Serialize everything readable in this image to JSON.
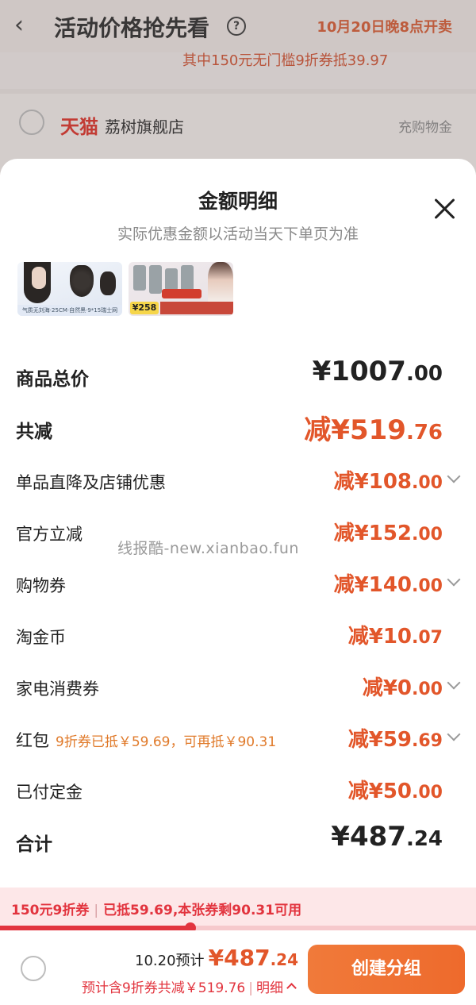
{
  "background": {
    "title": "活动价格抢先看",
    "sale_time": "10月20日晚8点开卖",
    "coupon_line": "其中150元无门槛9折券抵39.97",
    "tmall_logo": "天猫",
    "shop_name": "荔树旗舰店",
    "gather_link": "充购物金"
  },
  "sheet": {
    "title": "金额明细",
    "subtitle": "实际优惠金额以活动当天下单页为准",
    "thumb1_caption": "气质无刘海·25CM·自然黑·9*15瑞士网",
    "thumb2_price": "¥258"
  },
  "rows": [
    {
      "label": "商品总价",
      "amount": "¥1007",
      "dec": ".00"
    },
    {
      "label": "共减",
      "amount": "减¥519",
      "dec": ".76"
    },
    {
      "label": "单品直降及店铺优惠",
      "amount": "减¥108",
      "dec": ".00"
    },
    {
      "label": "官方立减",
      "amount": "减¥152",
      "dec": ".00"
    },
    {
      "label": "购物券",
      "amount": "减¥140",
      "dec": ".00"
    },
    {
      "label": "淘金币",
      "amount": "减¥10",
      "dec": ".07"
    },
    {
      "label": "家电消费券",
      "amount": "减¥0",
      "dec": ".00"
    },
    {
      "label": "红包",
      "note": "9折券已抵￥59.69，可再抵￥90.31",
      "amount": "减¥59",
      "dec": ".69"
    },
    {
      "label": "已付定金",
      "amount": "减¥50",
      "dec": ".00"
    },
    {
      "label": "合计",
      "amount": "¥487",
      "dec": ".24"
    }
  ],
  "watermark": "线报酷-new.xianbao.fun",
  "promo": {
    "coupon": "150元9折券",
    "status": "已抵59.69,本张券剩90.31可用",
    "progress_fraction": 0.4
  },
  "bottom": {
    "prefix": "10.20预计",
    "price": "¥487",
    "price_dec": ".24",
    "detail": "预计含9折券共减￥519.76",
    "detail_link": "明细",
    "create_button": "创建分组"
  },
  "colors": {
    "accent": "#e2562a",
    "red": "#e2343e",
    "button": "#ee6a2c"
  }
}
